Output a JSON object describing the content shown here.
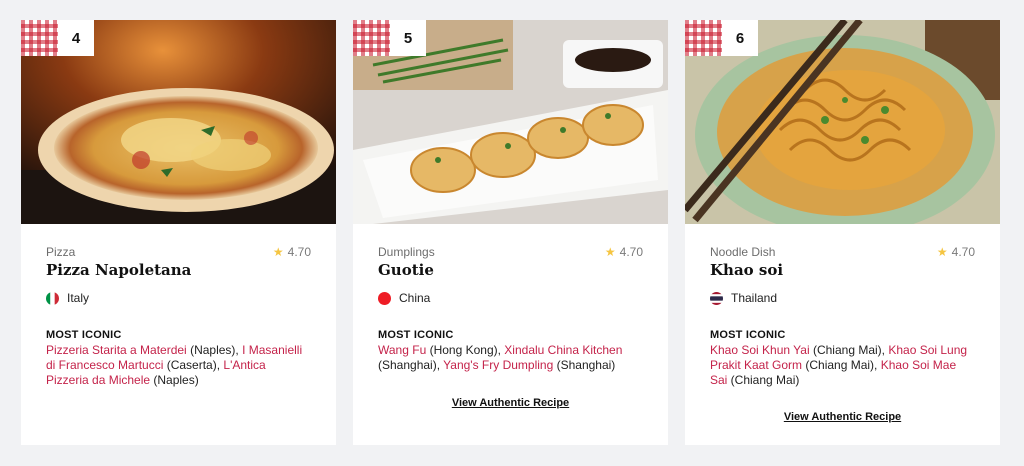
{
  "cards": [
    {
      "rank": "4",
      "category": "Pizza",
      "rating": "4.70",
      "title": "Pizza Napoletana",
      "country": "Italy",
      "iconic_label": "MOST ICONIC",
      "places": [
        {
          "name": "Pizzeria Starita a Materdei",
          "loc": " (Naples), "
        },
        {
          "name": "I Masanielli di Francesco Martucci",
          "loc": " (Caserta), "
        },
        {
          "name": "L'Antica Pizzeria da Michele",
          "loc": " (Naples)"
        }
      ],
      "recipe_link": ""
    },
    {
      "rank": "5",
      "category": "Dumplings",
      "rating": "4.70",
      "title": "Guotie",
      "country": "China",
      "iconic_label": "MOST ICONIC",
      "places": [
        {
          "name": "Wang Fu",
          "loc": " (Hong Kong), "
        },
        {
          "name": "Xindalu China Kitchen",
          "loc": " (Shanghai), "
        },
        {
          "name": "Yang's Fry Dumpling",
          "loc": " (Shanghai)"
        }
      ],
      "recipe_link": "View Authentic Recipe"
    },
    {
      "rank": "6",
      "category": "Noodle Dish",
      "rating": "4.70",
      "title": "Khao soi",
      "country": "Thailand",
      "iconic_label": "MOST ICONIC",
      "places": [
        {
          "name": "Khao Soi Khun Yai",
          "loc": " (Chiang Mai), "
        },
        {
          "name": "Khao Soi Lung Prakit Kaat Gorm",
          "loc": " (Chiang Mai), "
        },
        {
          "name": "Khao Soi Mae Sai",
          "loc": " (Chiang Mai)"
        }
      ],
      "recipe_link": "View Authentic Recipe"
    }
  ],
  "colors": {
    "link": "#c4234a",
    "star": "#f5c542"
  },
  "icons": {
    "star": "star-icon",
    "flags": [
      "italy-flag-icon",
      "china-flag-icon",
      "thailand-flag-icon"
    ]
  }
}
